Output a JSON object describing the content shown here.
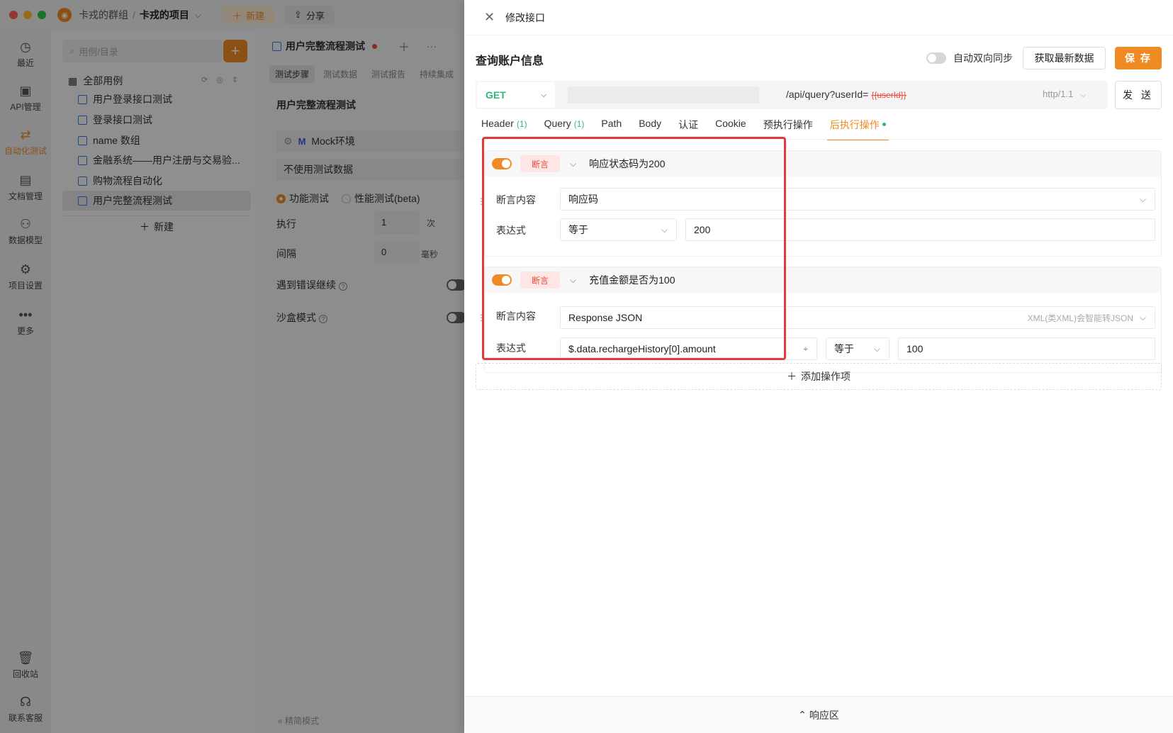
{
  "titlebar": {
    "group": "卡戎的群组",
    "separator": "/",
    "project": "卡戎的项目",
    "new_label": "新建",
    "share_label": "分享"
  },
  "leftnav": {
    "items": [
      {
        "label": "最近",
        "icon": "clock-icon"
      },
      {
        "label": "API管理",
        "icon": "api-icon"
      },
      {
        "label": "自动化测试",
        "icon": "flow-icon"
      },
      {
        "label": "文档管理",
        "icon": "document-icon"
      },
      {
        "label": "数据模型",
        "icon": "model-icon"
      },
      {
        "label": "项目设置",
        "icon": "settings-icon"
      },
      {
        "label": "更多",
        "icon": "more-icon"
      }
    ],
    "bottom": [
      {
        "label": "回收站",
        "icon": "trash-icon"
      },
      {
        "label": "联系客服",
        "icon": "headset-icon"
      }
    ],
    "active_color": "#f08a24"
  },
  "casepanel": {
    "search_placeholder": "用例/目录",
    "root_label": "全部用例",
    "items": [
      "用户登录接口测试",
      "登录接口测试",
      "name 数组",
      "金融系统——用户注册与交易验...",
      "购物流程自动化",
      "用户完整流程测试"
    ],
    "new_label": "新建"
  },
  "mainpanel": {
    "tab_title": "用户完整流程测试",
    "subtabs": [
      "测试步骤",
      "测试数据",
      "测试报告",
      "持续集成"
    ],
    "flow_title": "用户完整流程测试",
    "env_badge": "M",
    "env_name": "Mock环境",
    "data_select": "不使用测试数据",
    "radio_functional": "功能测试",
    "radio_perf": "性能测试(beta)",
    "exec_label": "执行",
    "exec_value": "1",
    "exec_unit": "次",
    "interval_label": "间隔",
    "interval_value": "0",
    "interval_unit": "毫秒",
    "continue_on_error": "遇到错误继续",
    "sandbox_mode": "沙盒模式",
    "simple_mode": "精简模式"
  },
  "drawer": {
    "title": "修改接口",
    "request_name": "查询账户信息",
    "sync_label": "自动双向同步",
    "fetch_label": "获取最新数据",
    "save_label": "保 存",
    "method": "GET",
    "url_path": "/api/query?userId=",
    "url_var": "{{userId}}",
    "http_version": "http/1.1",
    "send_label": "发 送",
    "tabs": [
      {
        "label": "Header",
        "count": "(1)"
      },
      {
        "label": "Query",
        "count": "(1)"
      },
      {
        "label": "Path",
        "count": ""
      },
      {
        "label": "Body",
        "count": ""
      },
      {
        "label": "认证",
        "count": ""
      },
      {
        "label": "Cookie",
        "count": ""
      },
      {
        "label": "预执行操作",
        "count": ""
      },
      {
        "label": "后执行操作",
        "count": ""
      }
    ],
    "active_tab": "后执行操作",
    "assertions": [
      {
        "tag": "断言",
        "name": "响应状态码为200",
        "content_label": "断言内容",
        "content_value": "响应码",
        "expr_label": "表达式",
        "operator": "等于",
        "expected": "200"
      },
      {
        "tag": "断言",
        "name": "充值金额是否为100",
        "content_label": "断言内容",
        "content_value": "Response JSON",
        "content_hint": "XML(类XML)会智能转JSON",
        "expr_label": "表达式",
        "expression": "$.data.rechargeHistory[0].amount",
        "operator": "等于",
        "expected": "100"
      }
    ],
    "add_op_label": "添加操作项",
    "response_label": "响应区"
  },
  "colors": {
    "accent": "#f08a24",
    "get_method": "#2eb872",
    "highlight_box": "#e03a3a",
    "assert_tag": "#e74c3c"
  }
}
